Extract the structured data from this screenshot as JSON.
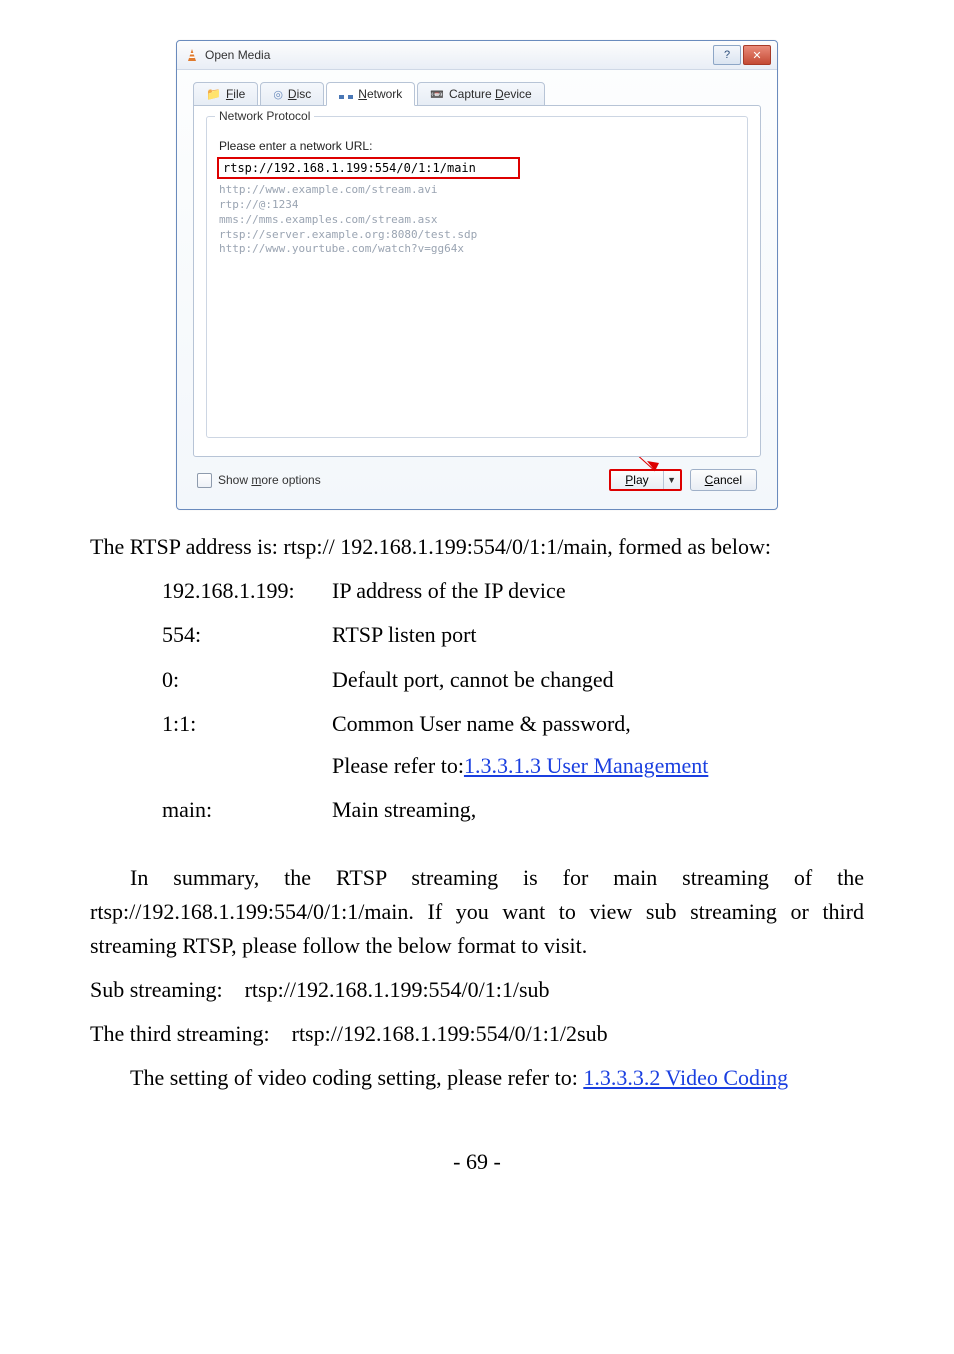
{
  "dialog": {
    "title": "Open Media",
    "winbtns": {
      "help": "?",
      "close": "✕"
    },
    "tabs": {
      "file": "File",
      "disc": "Disc",
      "network": "Network",
      "capture": "Capture Device"
    },
    "groupbox_legend": "Network Protocol",
    "prompt": "Please enter a network URL:",
    "url_value": "rtsp://192.168.1.199:554/0/1:1/main",
    "examples": [
      "http://www.example.com/stream.avi",
      "rtp://@:1234",
      "mms://mms.examples.com/stream.asx",
      "rtsp://server.example.org:8080/test.sdp",
      "http://www.yourtube.com/watch?v=gg64x"
    ],
    "show_more": "Show more options",
    "play": "Play",
    "cancel": "Cancel"
  },
  "doc": {
    "intro": "The RTSP address is: rtsp:// 192.168.1.199:554/0/1:1/main, formed as below:",
    "defs": [
      {
        "k": "192.168.1.199:",
        "v": "IP address of the IP device"
      },
      {
        "k": "554:",
        "v": "RTSP listen port"
      },
      {
        "k": "0:",
        "v": "Default port, cannot be changed"
      },
      {
        "k": "1:1:",
        "v": "Common User name & password,"
      },
      {
        "sub_prefix": "Please refer to:",
        "sub_link": "1.3.3.1.3 User Management"
      },
      {
        "k": "main:",
        "v": "Main streaming,"
      }
    ],
    "summary": "In summary, the RTSP streaming is for main streaming of the rtsp://192.168.1.199:554/0/1:1/main. If you want to view sub streaming or third streaming RTSP, please follow the below format to visit.",
    "sub_line": "Sub streaming:    rtsp://192.168.1.199:554/0/1:1/sub",
    "third_line": "The third streaming:    rtsp://192.168.1.199:554/0/1:1/2sub",
    "setting_prefix": "The setting of video coding setting, please refer to: ",
    "setting_link": "1.3.3.3.2 Video Coding",
    "pagenum": "- 69 -"
  }
}
